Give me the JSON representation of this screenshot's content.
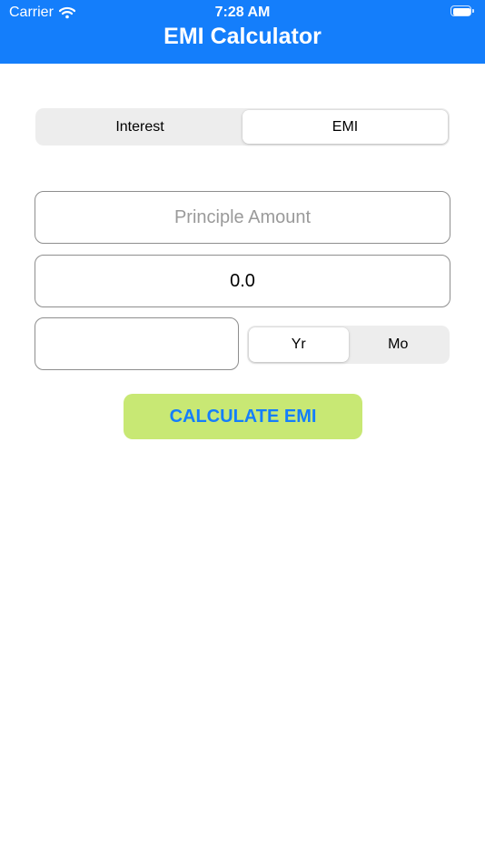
{
  "status_bar": {
    "carrier": "Carrier",
    "time": "7:28 AM",
    "wifi_icon": "wifi-icon",
    "battery_icon": "battery-icon"
  },
  "header": {
    "title": "EMI Calculator",
    "background_color": "#147EFB"
  },
  "mode_selector": {
    "segments": [
      "Interest",
      "EMI"
    ],
    "selected": "EMI"
  },
  "form": {
    "principle_placeholder": "Principle Amount",
    "rate_value": "0.0",
    "tenure_value": ""
  },
  "period_selector": {
    "segments": [
      "Yr",
      "Mo"
    ],
    "selected": "Yr"
  },
  "actions": {
    "calculate_label": "CALCULATE EMI",
    "button_color": "#C8E874",
    "button_text_color": "#147EFB"
  }
}
